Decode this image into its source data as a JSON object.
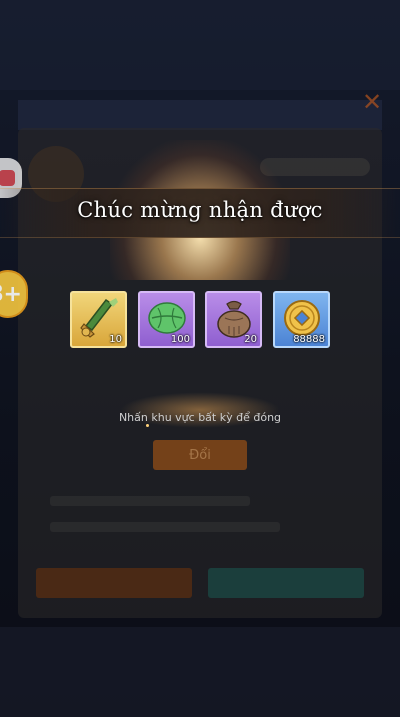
{
  "popup": {
    "title": "Chúc mừng nhận được",
    "hint": "Nhấn khu vực bất kỳ để đóng",
    "rewards": [
      {
        "icon": "sword-icon",
        "count": "10",
        "frame": "gold"
      },
      {
        "icon": "leaf-icon",
        "count": "100",
        "frame": "purple"
      },
      {
        "icon": "pouch-icon",
        "count": "20",
        "frame": "purple"
      },
      {
        "icon": "coin-icon",
        "count": "88888",
        "frame": "blue"
      }
    ]
  },
  "background": {
    "side_badge_label": "8+",
    "confirm_label": "Đổi"
  },
  "colors": {
    "gold_frame": "#d9a63a",
    "purple_frame": "#8f5fd0",
    "blue_frame": "#4c83d4",
    "accent_orange": "#b4541d"
  }
}
